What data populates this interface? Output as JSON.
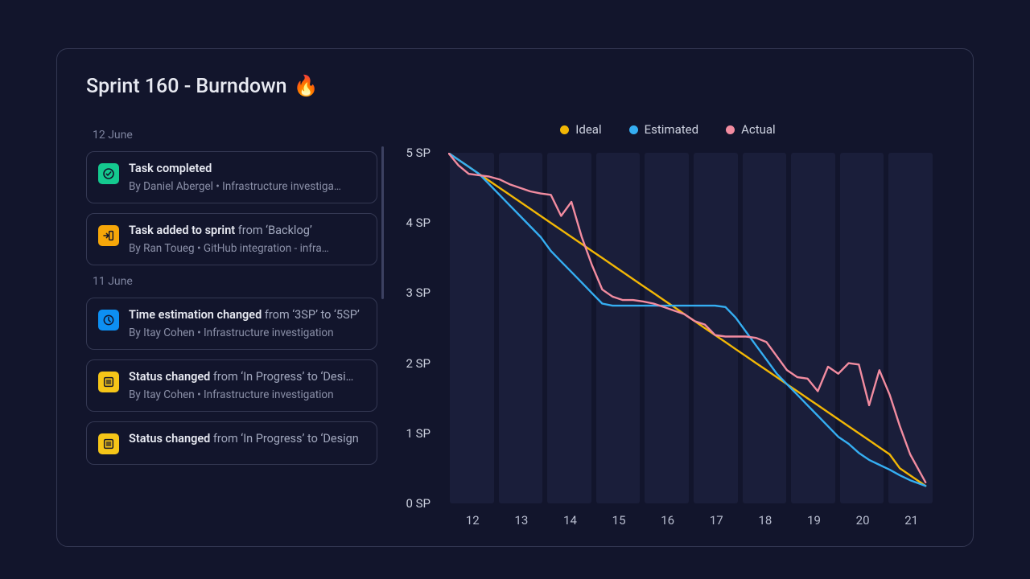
{
  "title": "Sprint 160 - Burndown",
  "title_emoji": "🔥",
  "feed": {
    "groups": [
      {
        "date": "12 June",
        "items": [
          {
            "icon": "check",
            "color": "green",
            "title_bold": "Task completed",
            "title_suffix": "",
            "sub": "By Daniel Abergel • Infrastructure investiga…"
          },
          {
            "icon": "arrow-in",
            "color": "orange",
            "title_bold": "Task added to sprint",
            "title_suffix": " from ‘Backlog’",
            "sub": "By Ran Toueg • GitHub integration - infra…"
          }
        ]
      },
      {
        "date": "11 June",
        "items": [
          {
            "icon": "clock",
            "color": "blue",
            "title_bold": "Time estimation changed",
            "title_suffix": " from ‘3SP’ to ‘5SP’",
            "sub": "By Itay Cohen • Infrastructure investigation"
          },
          {
            "icon": "list",
            "color": "yellow",
            "title_bold": "Status changed",
            "title_suffix": " from ‘In Progress’ to ‘Desi…",
            "sub": "By Itay Cohen • Infrastructure investigation"
          },
          {
            "icon": "list",
            "color": "yellow",
            "title_bold": "Status changed",
            "title_suffix": " from ‘In Progress’ to ‘Design",
            "sub": ""
          }
        ]
      }
    ]
  },
  "legend": {
    "ideal": "Ideal",
    "estimated": "Estimated",
    "actual": "Actual"
  },
  "colors": {
    "ideal": "#f2b705",
    "estimated": "#35aef2",
    "actual": "#f28ca0"
  },
  "y_ticks": [
    "0 SP",
    "1 SP",
    "2 SP",
    "3 SP",
    "4 SP",
    "5 SP"
  ],
  "x_ticks": [
    "12",
    "13",
    "14",
    "15",
    "16",
    "17",
    "18",
    "19",
    "20",
    "21"
  ],
  "chart_data": {
    "type": "line",
    "title": "Sprint 160 - Burndown",
    "xlabel": "",
    "ylabel": "SP",
    "xlim": [
      12,
      21.5
    ],
    "ylim": [
      0,
      5
    ],
    "x": [
      12.0,
      12.2,
      12.4,
      12.6,
      12.8,
      13.0,
      13.2,
      13.4,
      13.6,
      13.8,
      14.0,
      14.2,
      14.4,
      14.6,
      14.8,
      15.0,
      15.2,
      15.4,
      15.6,
      15.8,
      16.0,
      16.2,
      16.4,
      16.6,
      16.8,
      17.0,
      17.2,
      17.4,
      17.6,
      17.8,
      18.0,
      18.2,
      18.4,
      18.6,
      18.8,
      19.0,
      19.2,
      19.4,
      19.6,
      19.8,
      20.0,
      20.2,
      20.4,
      20.6,
      20.8,
      21.0,
      21.3
    ],
    "series": [
      {
        "name": "Ideal",
        "values": [
          5.0,
          4.9,
          4.8,
          4.7,
          4.6,
          4.5,
          4.4,
          4.3,
          4.2,
          4.1,
          4.0,
          3.9,
          3.8,
          3.7,
          3.6,
          3.5,
          3.4,
          3.3,
          3.2,
          3.1,
          3.0,
          2.9,
          2.8,
          2.7,
          2.6,
          2.5,
          2.4,
          2.3,
          2.2,
          2.1,
          2.0,
          1.9,
          1.8,
          1.7,
          1.6,
          1.5,
          1.4,
          1.3,
          1.2,
          1.1,
          1.0,
          0.9,
          0.8,
          0.7,
          0.5,
          0.4,
          0.25
        ]
      },
      {
        "name": "Estimated",
        "values": [
          5.0,
          4.9,
          4.8,
          4.7,
          4.55,
          4.4,
          4.25,
          4.1,
          3.95,
          3.8,
          3.6,
          3.45,
          3.3,
          3.15,
          3.0,
          2.85,
          2.82,
          2.82,
          2.82,
          2.82,
          2.82,
          2.82,
          2.82,
          2.82,
          2.82,
          2.82,
          2.82,
          2.8,
          2.65,
          2.45,
          2.25,
          2.05,
          1.85,
          1.7,
          1.55,
          1.4,
          1.25,
          1.1,
          0.95,
          0.85,
          0.72,
          0.62,
          0.55,
          0.48,
          0.4,
          0.33,
          0.25
        ]
      },
      {
        "name": "Actual",
        "values": [
          5.0,
          4.82,
          4.7,
          4.68,
          4.66,
          4.62,
          4.55,
          4.5,
          4.45,
          4.42,
          4.4,
          4.1,
          4.3,
          3.8,
          3.4,
          3.05,
          2.95,
          2.9,
          2.9,
          2.88,
          2.85,
          2.8,
          2.75,
          2.7,
          2.6,
          2.55,
          2.4,
          2.38,
          2.38,
          2.38,
          2.36,
          2.3,
          2.1,
          1.9,
          1.8,
          1.78,
          1.6,
          1.95,
          1.85,
          2.0,
          1.98,
          1.4,
          1.9,
          1.55,
          1.1,
          0.7,
          0.3
        ]
      }
    ]
  }
}
